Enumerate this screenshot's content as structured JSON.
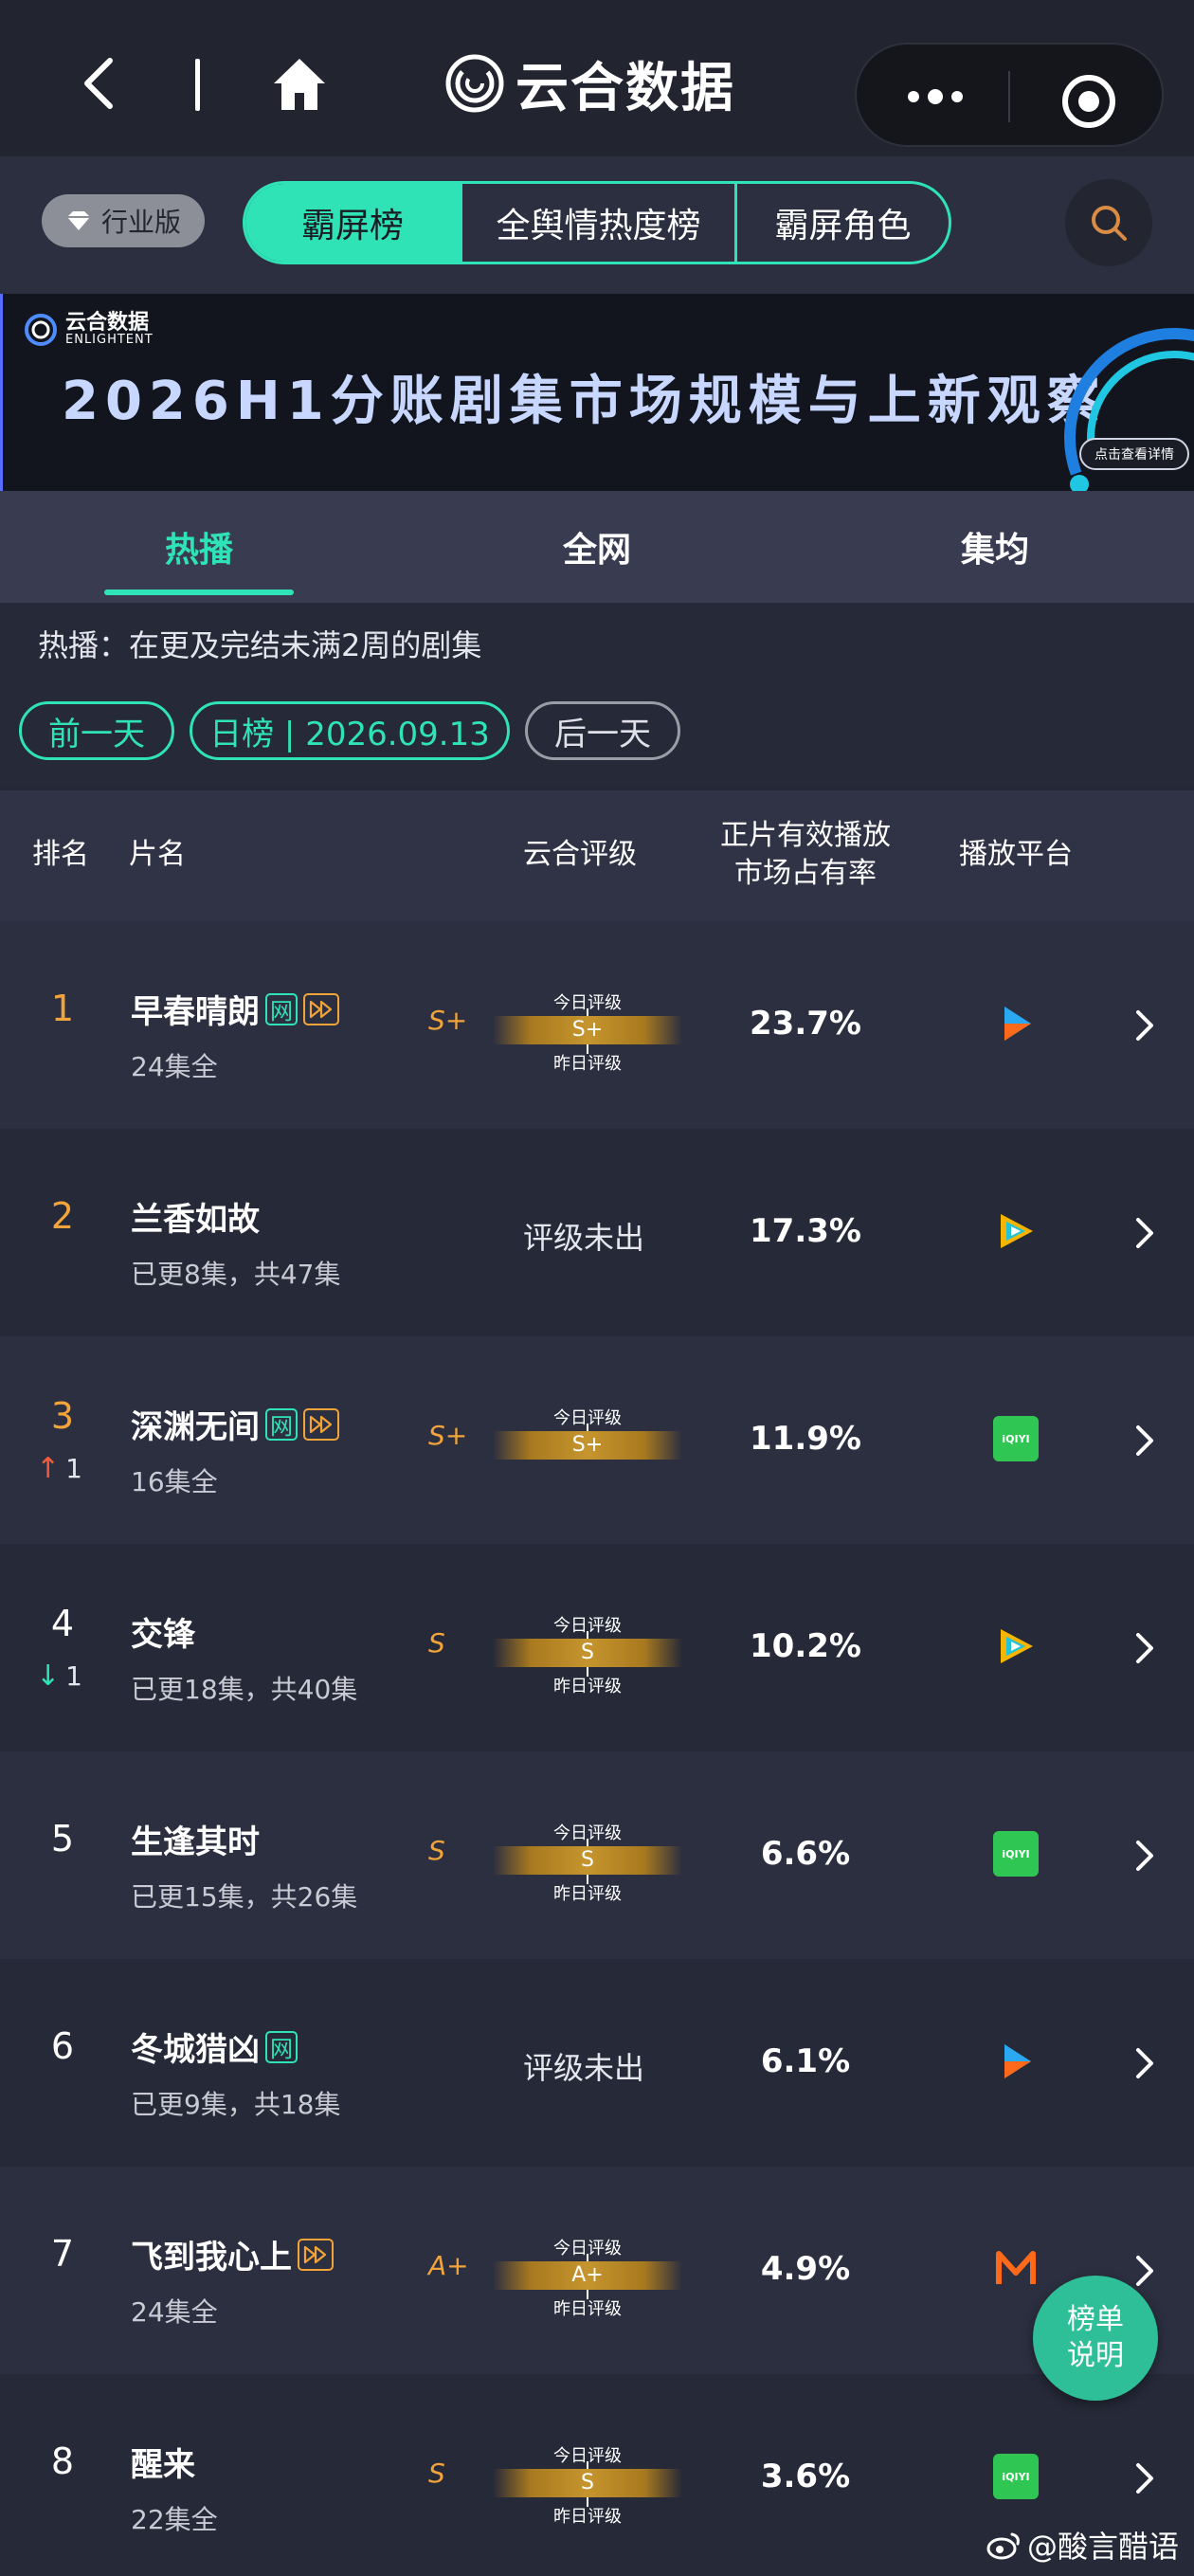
{
  "app": {
    "brand": "云合数据"
  },
  "toolbar": {
    "edition": "行业版",
    "segments": [
      "霸屏榜",
      "全舆情热度榜",
      "霸屏角色"
    ]
  },
  "banner": {
    "logo_cn": "云合数据",
    "logo_en": "ENLIGHTENT",
    "title": "2026H1分账剧集市场规模与上新观察",
    "cta": "点击查看详情"
  },
  "tabs": [
    "热播",
    "全网",
    "集均"
  ],
  "description": "热播：在更及完结未满2周的剧集",
  "date_nav": {
    "prev": "前一天",
    "current": "日榜 | 2026.09.13",
    "next": "后一天"
  },
  "table": {
    "headers": {
      "rank": "排名",
      "title": "片名",
      "rating": "云合评级",
      "share_line1": "正片有效播放",
      "share_line2": "市场占有率",
      "platform": "播放平台"
    },
    "grade_labels": {
      "today": "今日评级",
      "yesterday": "昨日评级"
    },
    "rows": [
      {
        "rank": "1",
        "title": "早春晴朗",
        "episodes": "24集全",
        "yesterday_grade": "S+",
        "today_grade": "S+",
        "share": "23.7%",
        "platform": "youku-icon"
      },
      {
        "rank": "2",
        "title": "兰香如故",
        "episodes": "已更8集，共47集",
        "no_grade": "评级未出",
        "share": "17.3%",
        "platform": "tencent-video-icon"
      },
      {
        "rank": "3",
        "title": "深渊无间",
        "episodes": "16集全",
        "change": "1",
        "yesterday_grade": "S+",
        "today_grade": "S+",
        "share": "11.9%",
        "platform": "iqiyi-icon"
      },
      {
        "rank": "4",
        "title": "交锋",
        "episodes": "已更18集，共40集",
        "change": "1",
        "yesterday_grade": "S",
        "today_grade": "S",
        "share": "10.2%",
        "platform": "tencent-video-icon"
      },
      {
        "rank": "5",
        "title": "生逢其时",
        "episodes": "已更15集，共26集",
        "yesterday_grade": "S",
        "today_grade": "S",
        "share": "6.6%",
        "platform": "iqiyi-icon"
      },
      {
        "rank": "6",
        "title": "冬城猎凶",
        "episodes": "已更9集，共18集",
        "no_grade": "评级未出",
        "share": "6.1%",
        "platform": "youku-icon"
      },
      {
        "rank": "7",
        "title": "飞到我心上",
        "episodes": "24集全",
        "yesterday_grade": "A+",
        "today_grade": "A+",
        "share": "4.9%",
        "platform": "mgtv-icon"
      },
      {
        "rank": "8",
        "title": "醒来",
        "episodes": "22集全",
        "yesterday_grade": "S",
        "today_grade": "S",
        "share": "3.6%",
        "platform": "iqiyi-icon"
      }
    ]
  },
  "badges": {
    "net": "网",
    "iqiyi": "iQIYI"
  },
  "fab": {
    "line1": "榜单",
    "line2": "说明"
  },
  "watermark": "@酸言醋语",
  "colors": {
    "accent": "#2fe3b6",
    "gold": "#f2a43b",
    "background": "#262938"
  }
}
